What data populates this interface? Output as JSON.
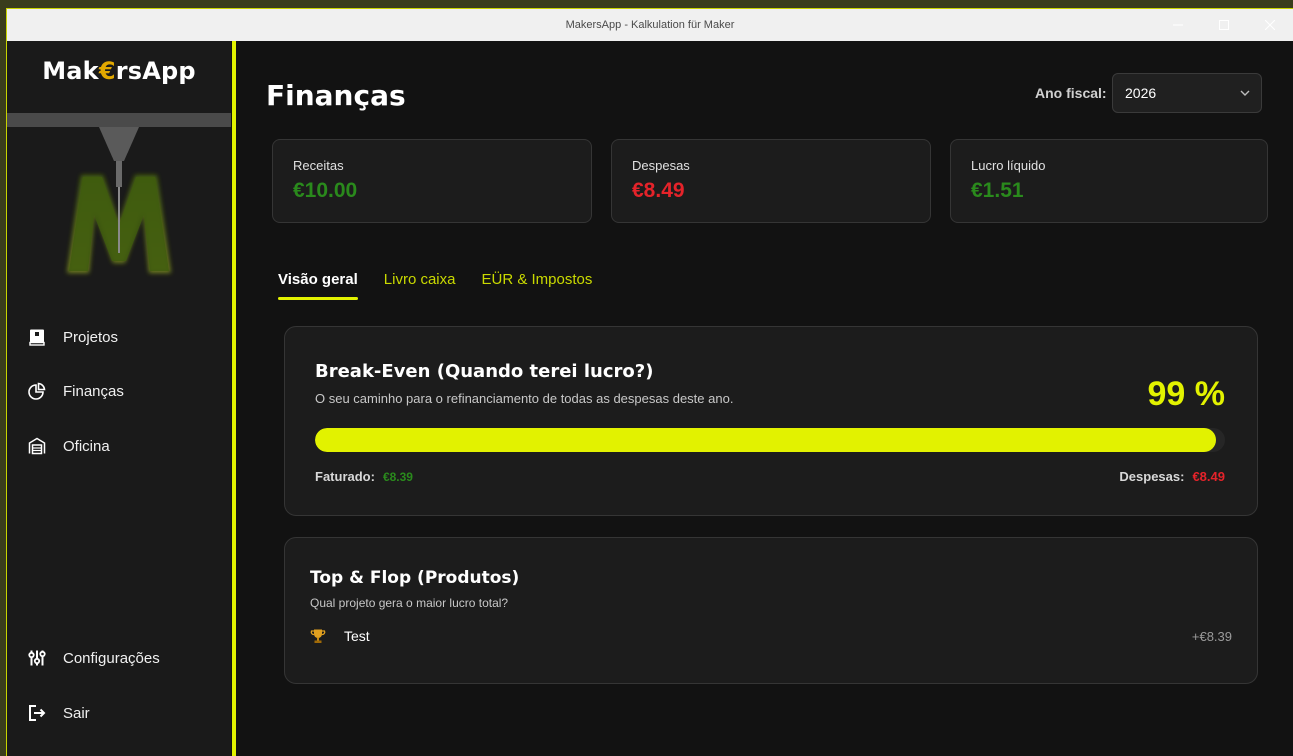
{
  "window": {
    "title": "MakersApp - Kalkulation für Maker"
  },
  "sidebar": {
    "brand": {
      "before": "Mak",
      "euro": "€",
      "after": "rsApp"
    },
    "items": [
      {
        "label": "Projetos",
        "icon": "book-icon"
      },
      {
        "label": "Finanças",
        "icon": "pie-chart-icon"
      },
      {
        "label": "Oficina",
        "icon": "garage-icon"
      },
      {
        "label": "Configurações",
        "icon": "sliders-icon"
      },
      {
        "label": "Sair",
        "icon": "exit-icon"
      }
    ]
  },
  "header": {
    "title": "Finanças",
    "fiscal_year_label": "Ano fiscal:",
    "fiscal_year_value": "2026"
  },
  "kpis": [
    {
      "label": "Receitas",
      "value": "€10.00",
      "color": "#2a8a1c"
    },
    {
      "label": "Despesas",
      "value": "€8.49",
      "color": "#e5232a"
    },
    {
      "label": "Lucro líquido",
      "value": "€1.51",
      "color": "#2a8a1c"
    }
  ],
  "tabs": [
    "Visão geral",
    "Livro caixa",
    "EÜR & Impostos"
  ],
  "breakeven": {
    "title": "Break-Even (Quando terei lucro?)",
    "subtitle": "O seu caminho para o refinanciamento de todas as despesas deste ano.",
    "percent_label": "99 %",
    "progress": 0.99,
    "invoiced_label": "Faturado:",
    "invoiced_value": "€8.39",
    "expenses_label": "Despesas:",
    "expenses_value": "€8.49"
  },
  "topflop": {
    "title": "Top & Flop (Produtos)",
    "subtitle": "Qual projeto gera o maior lucro total?",
    "rows": [
      {
        "icon": "trophy-icon",
        "name": "Test",
        "value": "+€8.39"
      }
    ]
  },
  "colors": {
    "accent": "#e2f200",
    "positive": "#2a8a1c",
    "negative": "#e5232a",
    "background": "#121212",
    "card": "#1c1c1c"
  }
}
